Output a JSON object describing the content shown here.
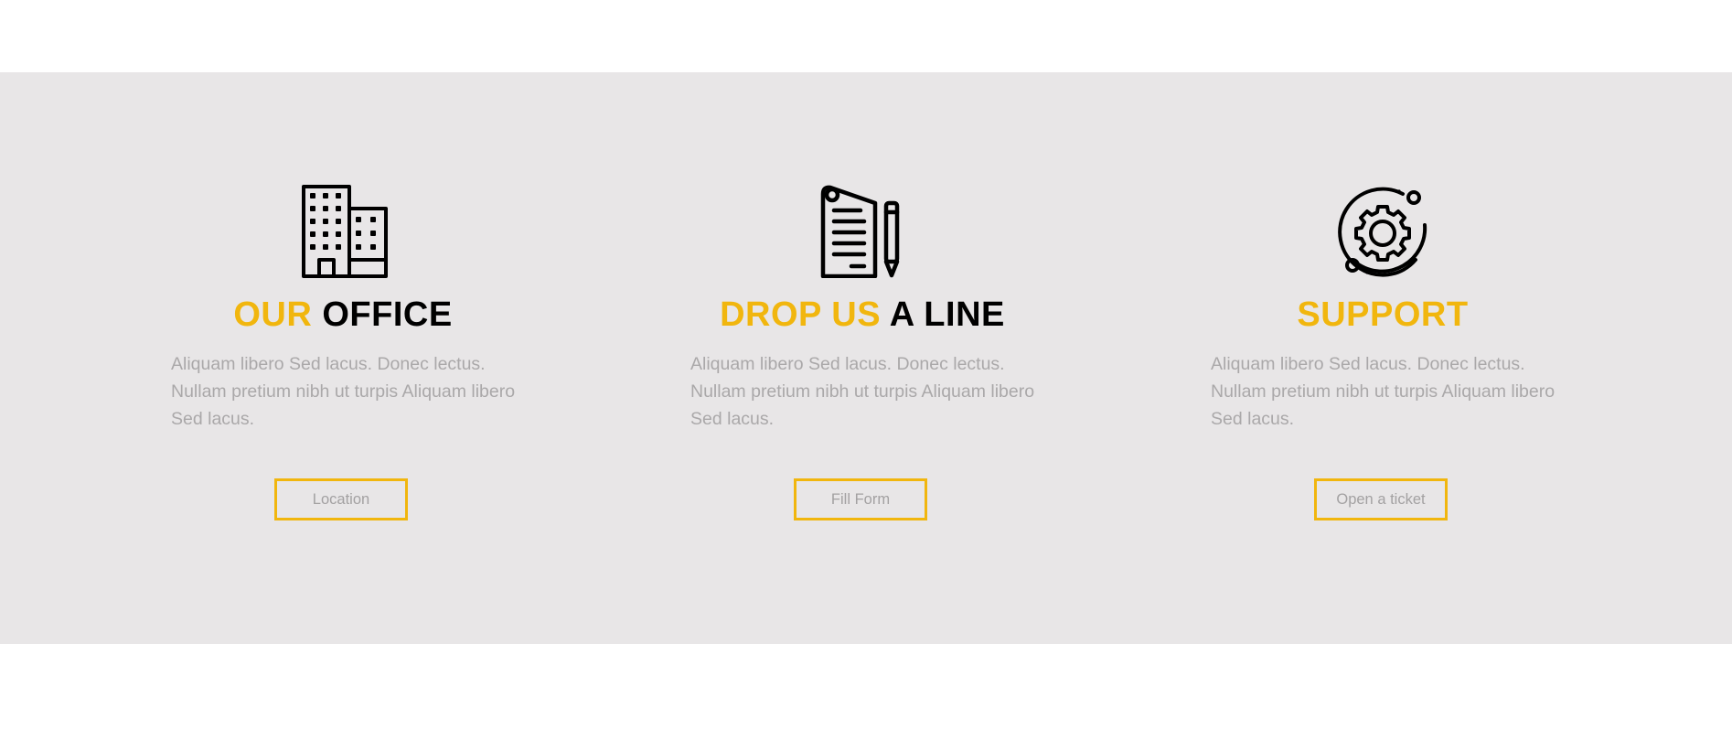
{
  "colors": {
    "accent": "#f1b60e",
    "section_background": "#e8e6e7",
    "body_text": "#aaa8a9",
    "heading_dark": "#000000"
  },
  "cards": [
    {
      "icon": "office-building-icon",
      "title_accent": "OUR",
      "title_dark": "OFFICE",
      "text": "Aliquam libero Sed lacus. Donec lectus. Nullam pretium nibh ut turpis Aliquam libero Sed lacus.",
      "button_label": "Location"
    },
    {
      "icon": "document-pencil-icon",
      "title_accent": "DROP US",
      "title_dark": "A LINE",
      "text": "Aliquam libero Sed lacus. Donec lectus. Nullam pretium nibh ut turpis Aliquam libero Sed lacus.",
      "button_label": "Fill Form"
    },
    {
      "icon": "gear-support-icon",
      "title_accent": "SUPPORT",
      "title_dark": "",
      "text": "Aliquam libero Sed lacus. Donec lectus. Nullam pretium nibh ut turpis Aliquam libero Sed lacus.",
      "button_label": "Open a ticket"
    }
  ]
}
